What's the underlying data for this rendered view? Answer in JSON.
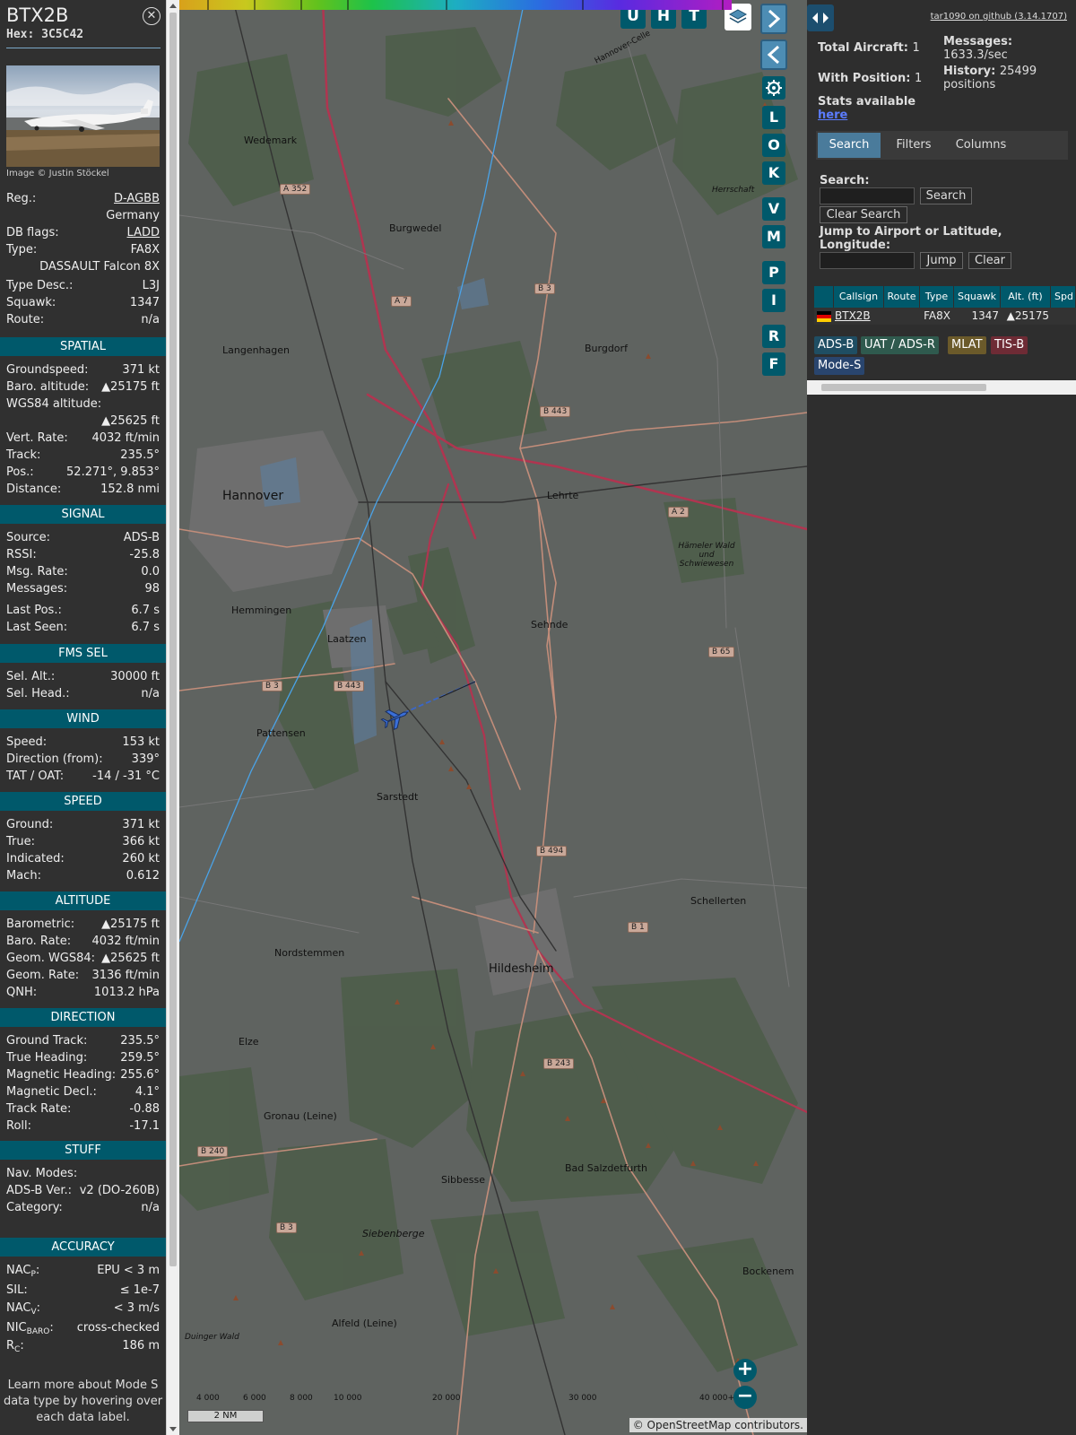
{
  "aircraft": {
    "callsign": "BTX2B",
    "hex": "Hex: 3C5C42",
    "image_credit": "Image © Justin Stöckel"
  },
  "basic": [
    {
      "label": "Reg.:",
      "value": "D-AGBB",
      "link": true
    },
    {
      "label": "",
      "value": "Germany"
    },
    {
      "label": "DB flags:",
      "value": "LADD",
      "link": true
    },
    {
      "label": "Type:",
      "value": "FA8X"
    },
    {
      "label": "",
      "value": "DASSAULT Falcon 8X"
    },
    {
      "label": "Type Desc.:",
      "value": "L3J"
    },
    {
      "label": "Squawk:",
      "value": "1347"
    },
    {
      "label": "Route:",
      "value": "n/a"
    }
  ],
  "sections": {
    "spatial": "SPATIAL",
    "signal": "SIGNAL",
    "fms": "FMS SEL",
    "wind": "WIND",
    "speed": "SPEED",
    "altitude": "ALTITUDE",
    "direction": "DIRECTION",
    "stuff": "STUFF",
    "accuracy": "ACCURACY"
  },
  "spatial": [
    {
      "label": "Groundspeed:",
      "value": "371 kt"
    },
    {
      "label": "Baro. altitude:",
      "value": "▲25175 ft"
    },
    {
      "label": "WGS84 altitude:",
      "value": ""
    },
    {
      "label": "",
      "value": "▲25625 ft"
    },
    {
      "label": "Vert. Rate:",
      "value": "4032 ft/min"
    },
    {
      "label": "Track:",
      "value": "235.5°"
    },
    {
      "label": "Pos.:",
      "value": "52.271°, 9.853°"
    },
    {
      "label": "Distance:",
      "value": "152.8 nmi"
    }
  ],
  "signal": [
    {
      "label": "Source:",
      "value": "ADS-B"
    },
    {
      "label": "RSSI:",
      "value": "-25.8"
    },
    {
      "label": "Msg. Rate:",
      "value": "0.0"
    },
    {
      "label": "Messages:",
      "value": "98"
    },
    {
      "label": "Last Pos.:",
      "value": "6.7 s"
    },
    {
      "label": "Last Seen:",
      "value": "6.7 s"
    }
  ],
  "fms": [
    {
      "label": "Sel. Alt.:",
      "value": "30000 ft"
    },
    {
      "label": "Sel. Head.:",
      "value": "n/a"
    }
  ],
  "wind": [
    {
      "label": "Speed:",
      "value": "153 kt"
    },
    {
      "label": "Direction (from):",
      "value": "339°"
    },
    {
      "label": "TAT / OAT:",
      "value": "-14 / -31 °C"
    }
  ],
  "speed": [
    {
      "label": "Ground:",
      "value": "371 kt"
    },
    {
      "label": "True:",
      "value": "366 kt"
    },
    {
      "label": "Indicated:",
      "value": "260 kt"
    },
    {
      "label": "Mach:",
      "value": "0.612"
    }
  ],
  "altitude": [
    {
      "label": "Barometric:",
      "value": "▲25175 ft"
    },
    {
      "label": "Baro. Rate:",
      "value": "4032 ft/min"
    },
    {
      "label": "Geom. WGS84:",
      "value": "▲25625 ft"
    },
    {
      "label": "Geom. Rate:",
      "value": "3136 ft/min"
    },
    {
      "label": "QNH:",
      "value": "1013.2 hPa"
    }
  ],
  "direction": [
    {
      "label": "Ground Track:",
      "value": "235.5°"
    },
    {
      "label": "True Heading:",
      "value": "259.5°"
    },
    {
      "label": "Magnetic Heading:",
      "value": "255.6°"
    },
    {
      "label": "Magnetic Decl.:",
      "value": "4.1°"
    },
    {
      "label": "Track Rate:",
      "value": "-0.88"
    },
    {
      "label": "Roll:",
      "value": "-17.1"
    }
  ],
  "stuff": [
    {
      "label": "Nav. Modes:",
      "value": ""
    },
    {
      "label": "ADS-B Ver.:",
      "value": "v2 (DO-260B)"
    },
    {
      "label": "Category:",
      "value": "n/a"
    }
  ],
  "accuracy": [
    {
      "label": "NAC",
      "sub": "P",
      "value": "EPU < 3 m"
    },
    {
      "label": "SIL:",
      "sub": "",
      "value": "≤ 1e-7"
    },
    {
      "label": "NAC",
      "sub": "V",
      "value": "< 3 m/s"
    },
    {
      "label": "NIC",
      "sub": "BARO",
      "value": "cross-checked"
    },
    {
      "label": "R",
      "sub": "C",
      "value": "186 m"
    }
  ],
  "learn_more": "Learn more about Mode S data type by hovering over each data label.",
  "map": {
    "top_buttons": [
      "U",
      "H",
      "T"
    ],
    "side_buttons": [
      "L",
      "O",
      "K",
      "V",
      "M",
      "P",
      "I",
      "R",
      "F"
    ],
    "places": [
      {
        "name": "Wedemark"
      },
      {
        "name": "Burgwedel"
      },
      {
        "name": "Langenhagen"
      },
      {
        "name": "Burgdorf"
      },
      {
        "name": "Hannover"
      },
      {
        "name": "Lehrte"
      },
      {
        "name": "Hemmingen"
      },
      {
        "name": "Sehnde"
      },
      {
        "name": "Laatzen"
      },
      {
        "name": "Pattensen"
      },
      {
        "name": "Sarstedt"
      },
      {
        "name": "Schellerten"
      },
      {
        "name": "Nordstemmen"
      },
      {
        "name": "Hildesheim"
      },
      {
        "name": "Elze"
      },
      {
        "name": "Gronau (Leine)"
      },
      {
        "name": "Bad Salzdetfurth"
      },
      {
        "name": "Sibbesse"
      },
      {
        "name": "Siebenberge"
      },
      {
        "name": "Bockenem"
      },
      {
        "name": "Alfeld (Leine)"
      },
      {
        "name": "Herrschaft"
      },
      {
        "name": "Hämeler Wald und Schwiewesen"
      },
      {
        "name": "Duinger Wald"
      },
      {
        "name": "Hannover-Celle"
      }
    ],
    "roads": [
      "A 352",
      "A 7",
      "B 3",
      "B 443",
      "A 2",
      "B 65",
      "B 3",
      "B 443",
      "B 494",
      "B 1",
      "B 243",
      "B 240",
      "B 3"
    ],
    "colorbar_ticks": [
      "4 000",
      "6 000",
      "8 000",
      "10 000",
      "20 000",
      "30 000",
      "40 000+"
    ],
    "scale": "2 NM",
    "attribution": "© OpenStreetMap contributors."
  },
  "right": {
    "github": "tar1090 on github (3.14.1707)",
    "total_label": "Total Aircraft:",
    "total_value": "1",
    "position_label": "With Position:",
    "position_value": "1",
    "stats_label": "Stats available",
    "stats_link": "here",
    "messages_label": "Messages:",
    "messages_value": "1633.3/sec",
    "history_label": "History:",
    "history_value": "25499 positions",
    "tabs": [
      "Search",
      "Filters",
      "Columns"
    ],
    "search_label": "Search:",
    "search_button": "Search",
    "clear_search": "Clear Search",
    "jump_label": "Jump to Airport or Latitude, Longitude:",
    "jump_button": "Jump",
    "clear_button": "Clear",
    "columns": [
      "",
      "Callsign",
      "Route",
      "Type",
      "Squawk",
      "Alt. (ft)",
      "Spd"
    ],
    "row": {
      "callsign": "BTX2B",
      "type": "FA8X",
      "squawk": "1347",
      "alt": "▲25175"
    },
    "badges": [
      {
        "label": "ADS-B",
        "color": "#1f4e63"
      },
      {
        "label": "UAT / ADS-R",
        "color": "#2f5a4e"
      },
      {
        "label": "MLAT",
        "color": "#6b5a2a"
      },
      {
        "label": "TIS-B",
        "color": "#6e2b35"
      },
      {
        "label": "Mode-S",
        "color": "#29456e"
      }
    ]
  }
}
